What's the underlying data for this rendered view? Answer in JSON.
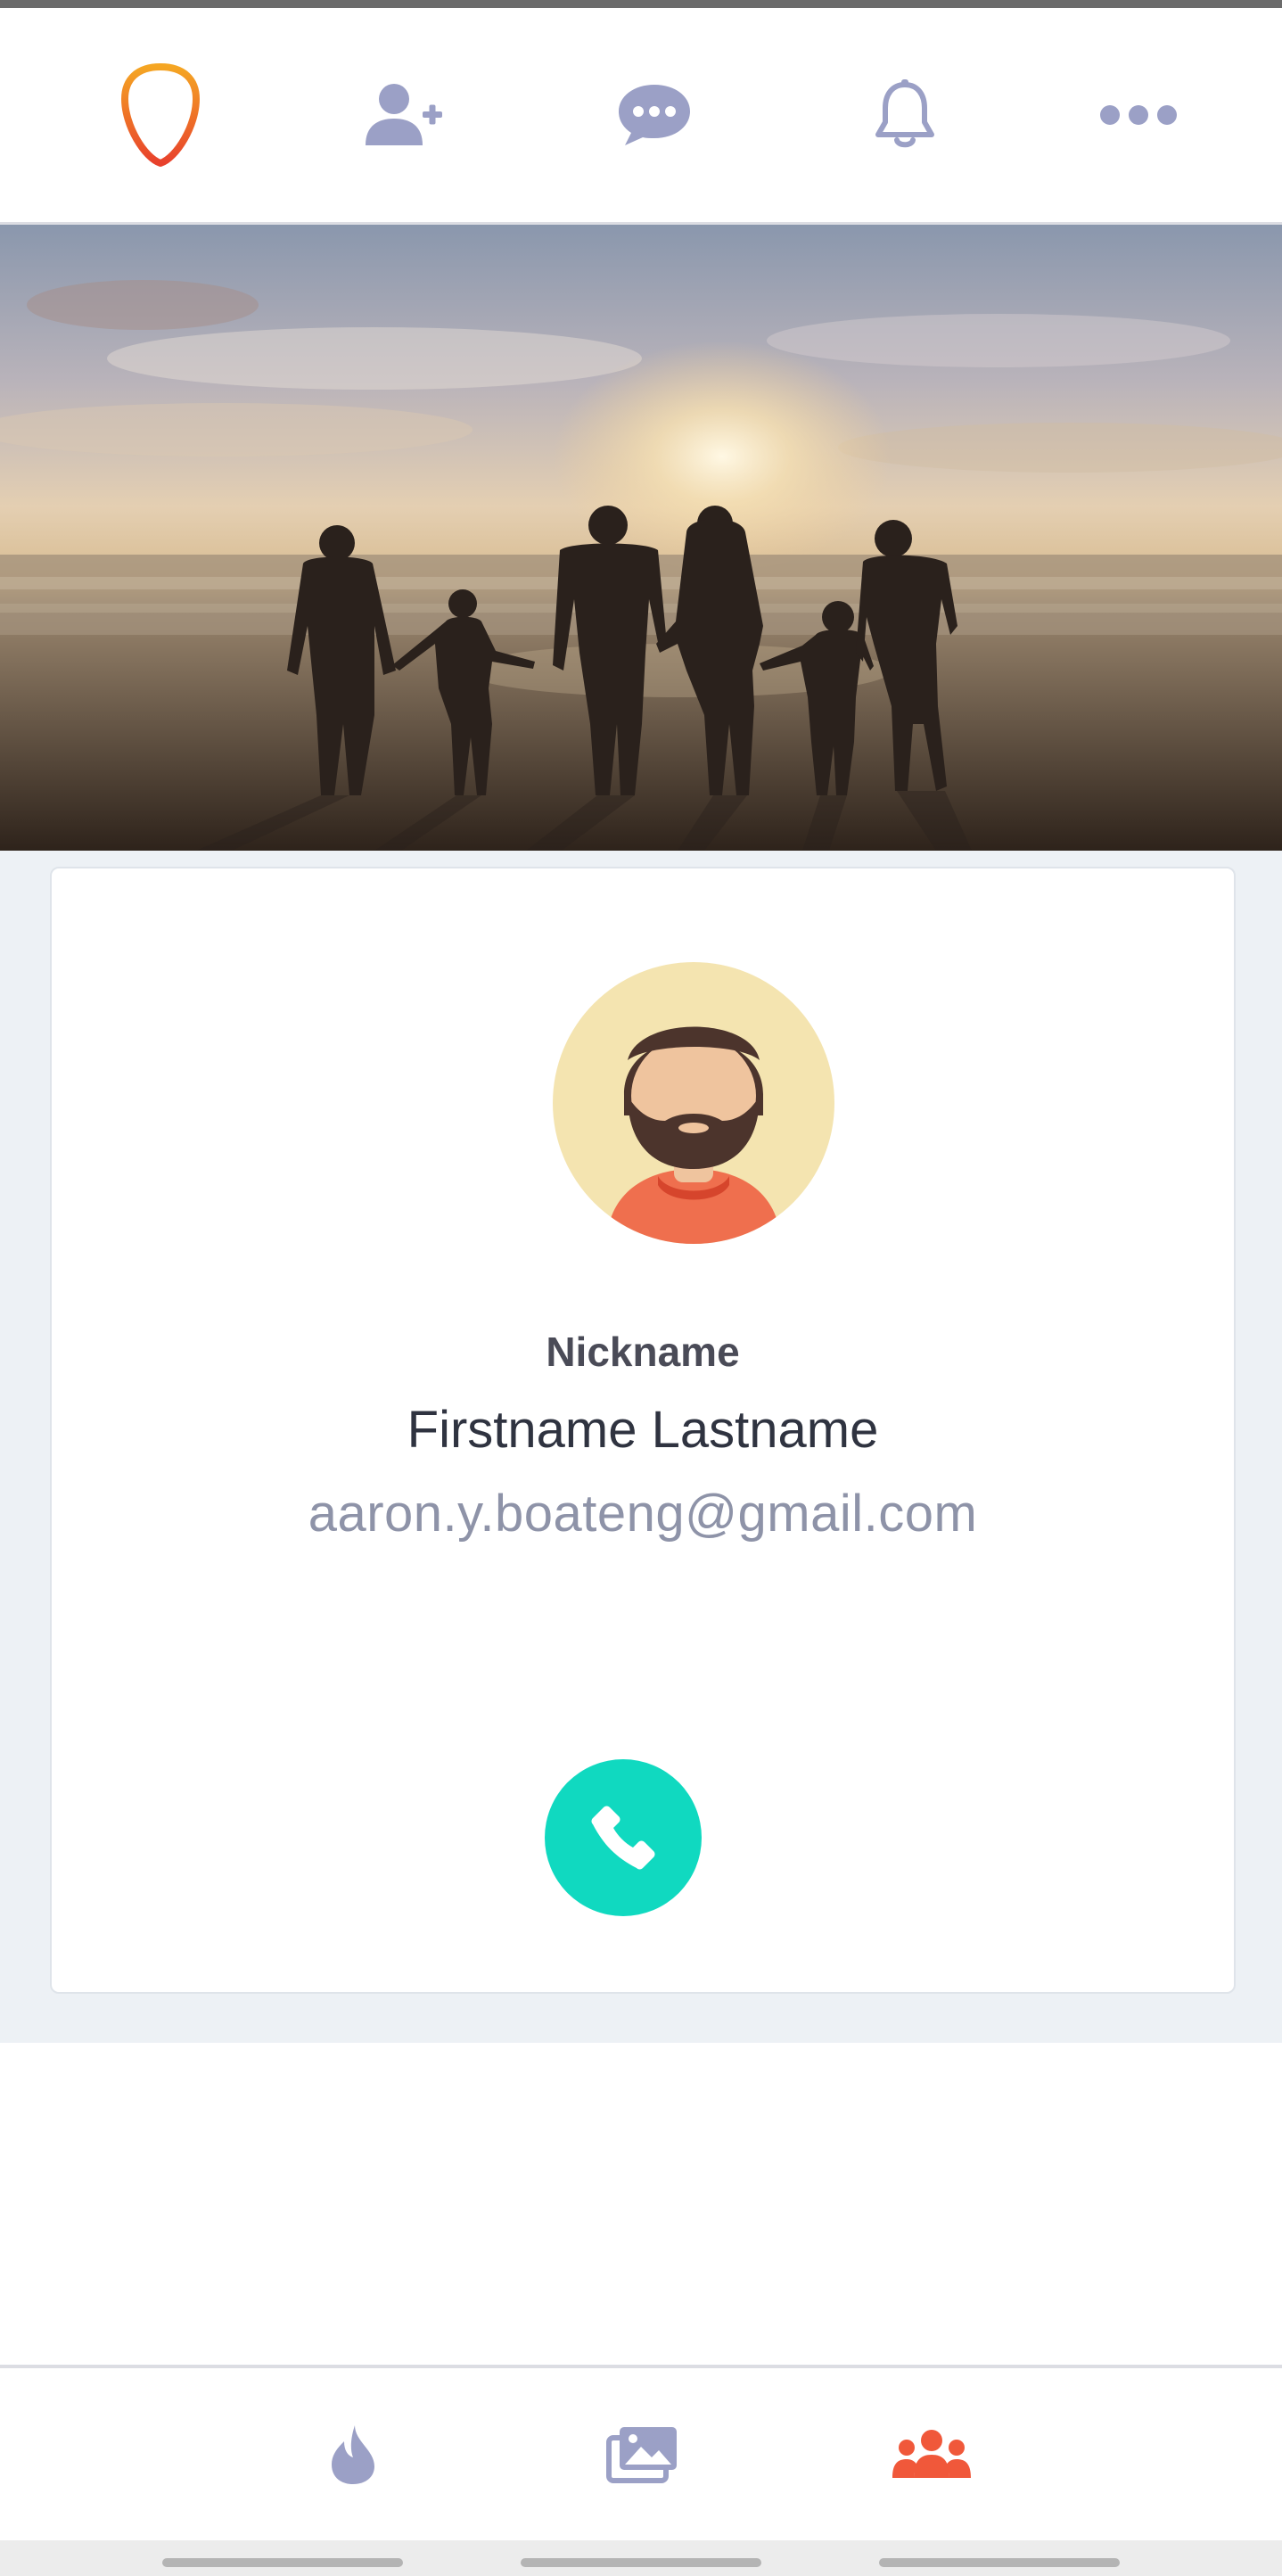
{
  "top_nav": {
    "items": [
      {
        "icon": "app-logo-icon",
        "color": "#ea6a1f"
      },
      {
        "icon": "add-user-icon",
        "color": "#9ba0c6"
      },
      {
        "icon": "chat-bubble-icon",
        "color": "#9ba0c6"
      },
      {
        "icon": "bell-icon",
        "color": "#9ba0c6"
      },
      {
        "icon": "more-dots-icon",
        "color": "#9ba0c6"
      }
    ]
  },
  "hero": {
    "image": "family-on-beach-at-sunset"
  },
  "profile": {
    "nickname": "Nickname",
    "full_name": "Firstname Lastname",
    "email": "aaron.y.boateng@gmail.com",
    "avatar_icon": "bearded-man-avatar-icon",
    "call_icon": "phone-icon",
    "call_color": "#10d9c0"
  },
  "bottom_nav": {
    "items": [
      {
        "icon": "flame-icon",
        "active": false,
        "color": "#9ba0c6"
      },
      {
        "icon": "photo-gallery-icon",
        "active": false,
        "color": "#9ba0c6"
      },
      {
        "icon": "group-icon",
        "active": true,
        "color": "#f0583a"
      }
    ]
  }
}
